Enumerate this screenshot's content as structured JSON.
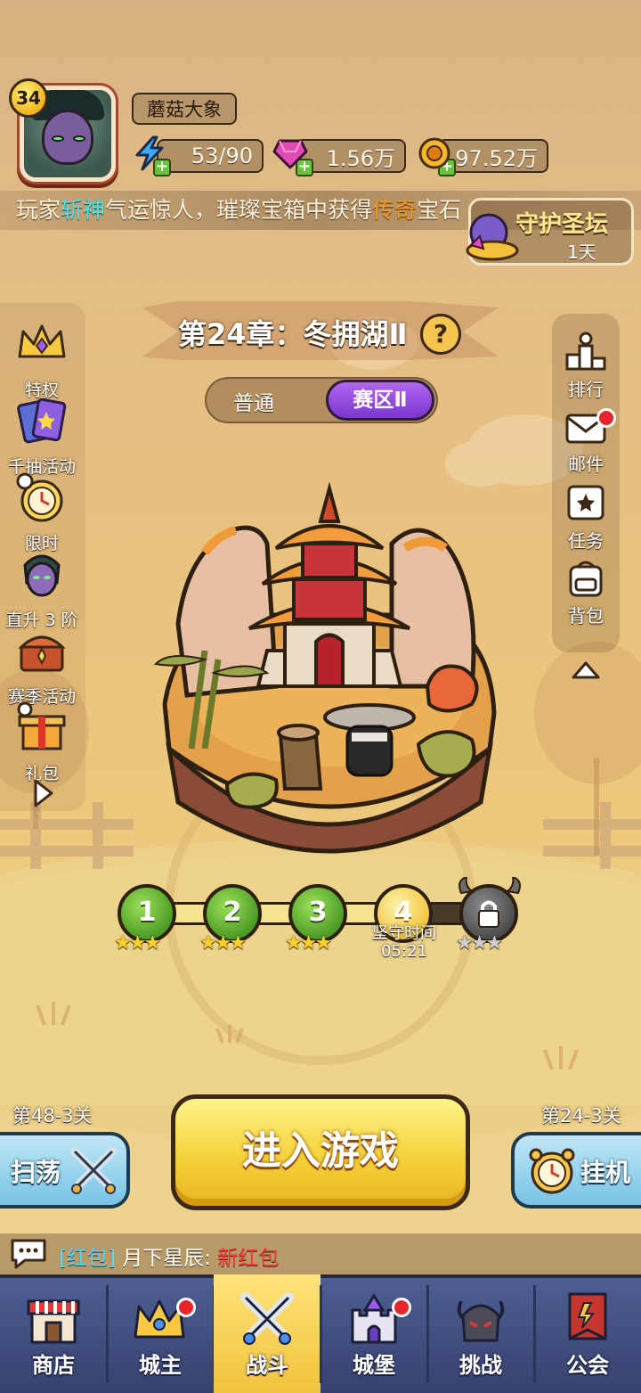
{
  "player": {
    "level": "34",
    "name": "蘑菇大象",
    "energy": "53/90",
    "gems": "1.56万",
    "gold": "97.52万"
  },
  "broadcast": {
    "prefix": "玩家",
    "player": "斩神",
    "middle": "气运惊人，璀璨宝箱中获得",
    "item": "传奇",
    "suffix": "宝石"
  },
  "guard_event": {
    "title": "守护圣坛",
    "time_left": "1天"
  },
  "left_sidebar": [
    {
      "label": "特权",
      "icon": "crown-icon"
    },
    {
      "label": "千抽活动",
      "icon": "card-pack-icon"
    },
    {
      "label": "限时",
      "icon": "alarm-clock-icon"
    },
    {
      "label": "直升 3 阶",
      "icon": "hero-portrait-icon"
    },
    {
      "label": "赛季活动",
      "icon": "treasure-chest-icon"
    },
    {
      "label": "礼包",
      "icon": "gift-box-icon"
    }
  ],
  "right_sidebar": [
    {
      "label": "排行",
      "icon": "podium-icon"
    },
    {
      "label": "邮件",
      "icon": "mail-icon"
    },
    {
      "label": "任务",
      "icon": "quest-scroll-icon"
    },
    {
      "label": "背包",
      "icon": "backpack-icon"
    }
  ],
  "chapter": {
    "title": "第24章：冬拥湖Ⅱ",
    "tabs": [
      "普通",
      "赛区Ⅱ"
    ],
    "active_tab": "赛区Ⅱ"
  },
  "stages": [
    {
      "number": "1",
      "stars": 3,
      "state": "cleared"
    },
    {
      "number": "2",
      "stars": 3,
      "state": "cleared"
    },
    {
      "number": "3",
      "stars": 3,
      "state": "cleared"
    },
    {
      "number": "4",
      "stars": 0,
      "state": "current",
      "label": "坚守时间",
      "time": "05:21"
    },
    {
      "number": "",
      "stars": 0,
      "state": "locked"
    }
  ],
  "actions": {
    "sweep_stage": "第48-3关",
    "sweep_label": "扫荡",
    "play_label": "进入游戏",
    "idle_stage": "第24-3关",
    "idle_label": "挂机"
  },
  "chat": {
    "tag": "[红包]",
    "sender": "月下星辰:",
    "message": "新红包"
  },
  "bottom_nav": [
    {
      "label": "商店",
      "icon": "shop-icon",
      "badge": false
    },
    {
      "label": "城主",
      "icon": "crown-icon",
      "badge": true
    },
    {
      "label": "战斗",
      "icon": "crossed-swords-icon",
      "badge": false,
      "active": true
    },
    {
      "label": "城堡",
      "icon": "castle-icon",
      "badge": true
    },
    {
      "label": "挑战",
      "icon": "demon-helmet-icon",
      "badge": false
    },
    {
      "label": "公会",
      "icon": "guild-banner-icon",
      "badge": false
    }
  ]
}
